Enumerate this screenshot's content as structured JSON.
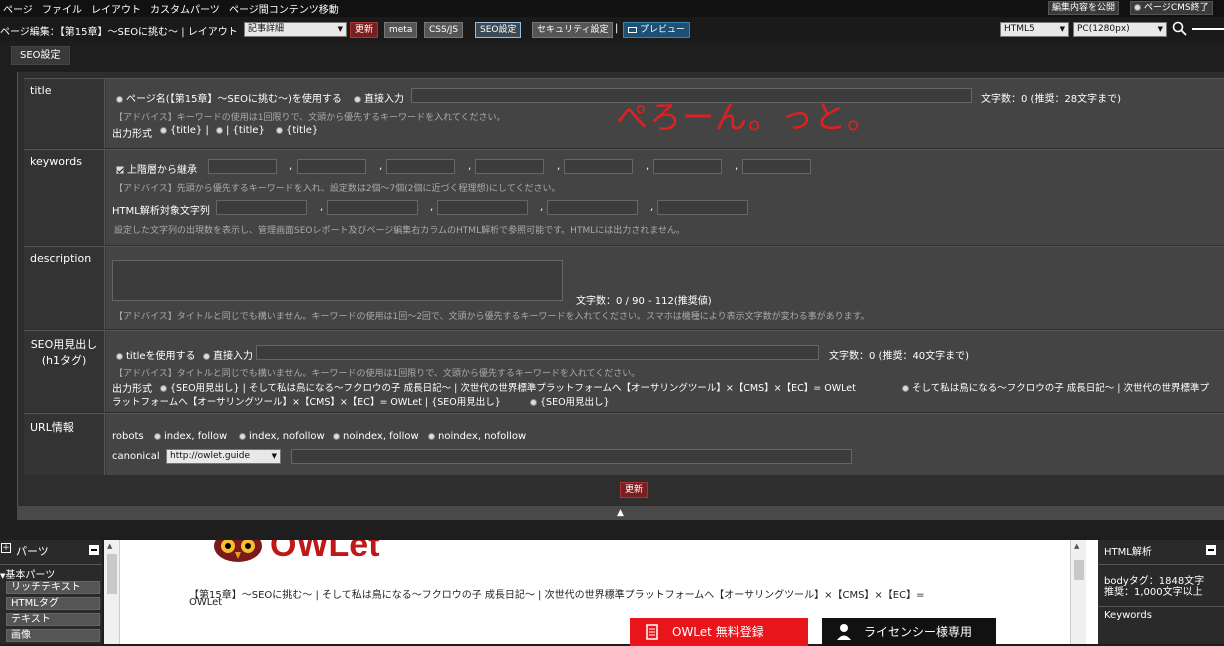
{
  "menubar": {
    "items": [
      "ページ",
      "ファイル",
      "レイアウト",
      "カスタムパーツ",
      "ページ間コンテンツ移動"
    ],
    "publish_label": "編集内容を公開",
    "exit_label": "ページCMS終了"
  },
  "toolbar": {
    "page_edit_label": "ページ編集：【第15章】～SEOに挑む～ | レイアウト",
    "layout_select": "記事詳細",
    "update_label": "更新",
    "meta_label": "meta",
    "cssjs_label": "CSS/JS",
    "seo_label": "SEO設定",
    "security_label": "セキュリティ設定",
    "separator": "|",
    "preview_label": "プレビュー",
    "doctype_select": "HTML5",
    "device_select": "PC(1280px)"
  },
  "tab": {
    "label": "SEO設定"
  },
  "annotation": "ぺろーん。っと。",
  "title_row": {
    "label": "title",
    "option_pagename": "ページ名(【第15章】～SEOに挑む～)を使用する",
    "option_direct": "直接入力",
    "count_text": "文字数：0 (推奨：28文字まで)",
    "advice": "【アドバイス】キーワードの使用は1回限りで、文頭から優先するキーワードを入れてください。",
    "format_label": "出力形式",
    "format_opt1": "{title} |",
    "format_opt2": "| {title}",
    "format_opt3": "{title}"
  },
  "keywords_row": {
    "label": "keywords",
    "inherit_label": "上階層から継承",
    "comma": ",",
    "advice": "【アドバイス】先頭から優先するキーワードを入れ、設定数は2個～7個(2個に近づく程理想)にしてください。",
    "html_label": "HTML解析対象文字列",
    "note": "設定した文字列の出現数を表示し、管理画面SEOレポート及びページ編集右カラムのHTML解析で参照可能です。HTMLには出力されません。"
  },
  "description_row": {
    "label": "description",
    "count_text": "文字数：0 / 90 - 112(推奨値)",
    "advice": "【アドバイス】タイトルと同じでも構いません。キーワードの使用は1回～2回で、文頭から優先するキーワードを入れてください。スマホは機種により表示文字数が変わる事があります。"
  },
  "h1_row": {
    "label_line1": "SEO用見出し",
    "label_line2": "(h1タグ)",
    "option_title": "titleを使用する",
    "option_direct": "直接入力",
    "count_text": "文字数：0 (推奨：40文字まで)",
    "advice": "【アドバイス】タイトルと同じでも構いません。キーワードの使用は1回限りで、文頭から優先するキーワードを入れてください。",
    "format_label": "出力形式",
    "format_line1": "{SEO用見出し} | そして私は鳥になる～フクロウの子 成長日記～ | 次世代の世界標準プラットフォームへ【オーサリングツール】×【CMS】×【EC】= OWLet",
    "format_line1b": "そして私は鳥になる～フクロウの子 成長日記～ | 次世代の世界標準プ",
    "format_line2": "ラットフォームへ【オーサリングツール】×【CMS】×【EC】= OWLet | {SEO用見出し}",
    "format_line2b": "{SEO用見出し}"
  },
  "url_row": {
    "label": "URL情報",
    "robots_label": "robots",
    "robots_options": [
      "index, follow",
      "index, nofollow",
      "noindex, follow",
      "noindex, nofollow"
    ],
    "canonical_label": "canonical",
    "canonical_select": "http://owlet.guide"
  },
  "update_bottom": "更新",
  "collapse_glyph": "▲",
  "parts_panel": {
    "title": "パーツ",
    "group": "基本パーツ",
    "items": [
      "リッチテキスト",
      "HTMLタグ",
      "テキスト",
      "画像"
    ]
  },
  "preview": {
    "logo_text": "OWLet",
    "breadcrumb_line1": "【第15章】～SEOに挑む～ | そして私は鳥になる～フクロウの子 成長日記～ | 次世代の世界標準プラットフォームへ【オーサリングツール】×【CMS】×【EC】=",
    "breadcrumb_line2": "OWLet",
    "cta_register": "OWLet 無料登録",
    "cta_license": "ライセンシー様専用"
  },
  "html_panel": {
    "title": "HTML解析",
    "body_tag": "bodyタグ：1848文字",
    "recommend": "推奨：1,000文字以上",
    "keywords_label": "Keywords"
  },
  "colors": {
    "accent_red": "#e02020",
    "update_red": "#7a1f1f",
    "cta_red": "#e8161b"
  }
}
